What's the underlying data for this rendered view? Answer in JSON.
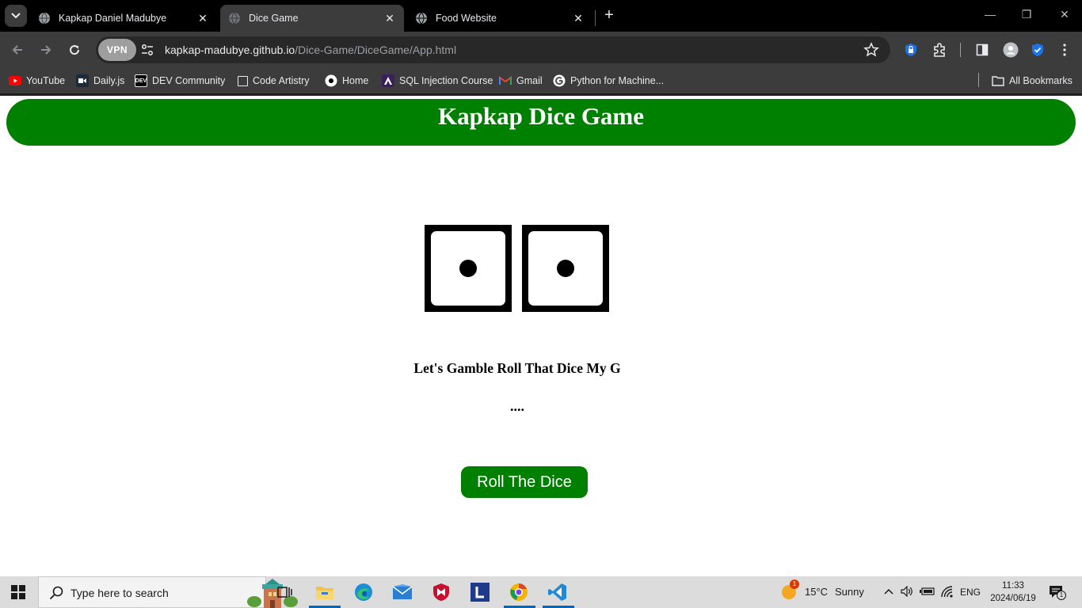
{
  "browser": {
    "tabs": [
      {
        "title": "Kapkap Daniel Madubye",
        "active": false
      },
      {
        "title": "Dice Game",
        "active": true
      },
      {
        "title": "Food Website",
        "active": false
      }
    ],
    "vpn_label": "VPN",
    "url_host": "kapkap-madubye.github.io",
    "url_path": "/Dice-Game/DiceGame/App.html",
    "bookmarks": [
      {
        "label": "YouTube",
        "icon": "youtube-icon"
      },
      {
        "label": "Daily.js",
        "icon": "daily-dev-icon"
      },
      {
        "label": "DEV Community",
        "icon": "dev-community-icon"
      },
      {
        "label": "Code Artistry",
        "icon": "code-artistry-icon"
      },
      {
        "label": "Home",
        "icon": "home-icon"
      },
      {
        "label": "SQL Injection Course",
        "icon": "sql-course-icon"
      },
      {
        "label": "Gmail",
        "icon": "gmail-icon"
      },
      {
        "label": "Python for Machine...",
        "icon": "google-icon"
      }
    ],
    "all_bookmarks_label": "All Bookmarks"
  },
  "page": {
    "banner_title": "Kapkap Dice Game",
    "dice": [
      {
        "value": 1
      },
      {
        "value": 1
      }
    ],
    "message": "Let's Gamble Roll That Dice My G",
    "result": "....",
    "roll_button": "Roll The Dice"
  },
  "taskbar": {
    "search_placeholder": "Type here to search",
    "weather_temp": "15°C",
    "weather_desc": "Sunny",
    "weather_badge": "1",
    "language": "ENG",
    "time": "11:33",
    "date": "2024/06/19",
    "notification_count": "1"
  },
  "colors": {
    "accent_green": "#008000",
    "browser_dark": "#3c3c3c"
  }
}
